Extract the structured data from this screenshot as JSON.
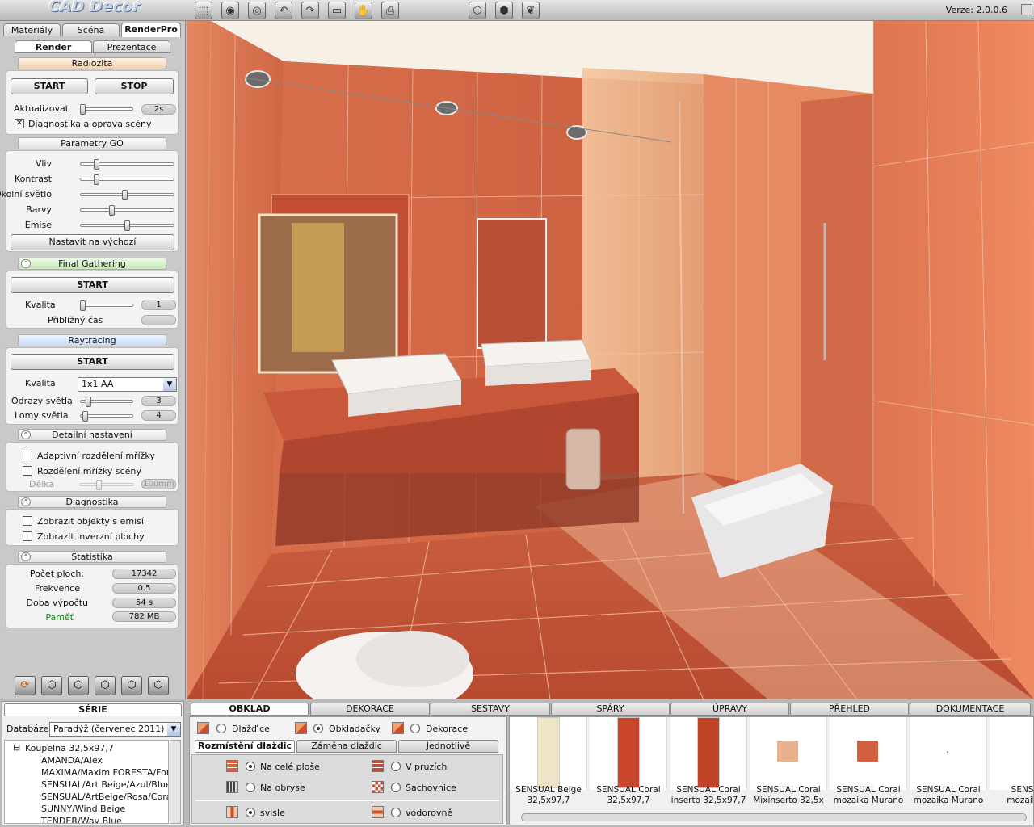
{
  "app": {
    "logo": "CAD Decor",
    "version": "Verze: 2.0.0.6"
  },
  "toolbar": {
    "icons": [
      "select-icon",
      "view-icon",
      "eye-icon",
      "undo-icon",
      "redo-icon",
      "window-icon",
      "hand-icon",
      "printer-icon",
      "cube-wire-icon",
      "cube-solid-icon",
      "butterfly-icon"
    ]
  },
  "left": {
    "tabs": [
      "Materiály",
      "Scéna",
      "RenderPro"
    ],
    "subtabs": [
      "Render",
      "Prezentace"
    ],
    "radiosity": {
      "title": "Radiozita",
      "start": "START",
      "stop": "STOP",
      "update_label": "Aktualizovat",
      "update_value": "2s",
      "update_level": 0.0,
      "diag_label": "Diagnostika a oprava scény",
      "diag_checked": true
    },
    "go": {
      "title": "Parametry GO",
      "reset": "Nastavit na výchozí",
      "params": [
        {
          "label": "Vliv",
          "level": 0.15
        },
        {
          "label": "Kontrast",
          "level": 0.15
        },
        {
          "label": "Okolní světlo",
          "level": 0.47
        },
        {
          "label": "Barvy",
          "level": 0.33
        },
        {
          "label": "Emise",
          "level": 0.5
        }
      ]
    },
    "fg": {
      "title": "Final Gathering",
      "start": "START",
      "quality_label": "Kvalita",
      "quality_value": "1",
      "quality_level": 0.0,
      "time_label": "Přibližný čas",
      "time_value": ""
    },
    "rt": {
      "title": "Raytracing",
      "start": "START",
      "quality_label": "Kvalita",
      "quality_value": "1x1 AA",
      "refl_label": "Odrazy světla",
      "refl_value": "3",
      "refl_level": 0.12,
      "refr_label": "Lomy světla",
      "refr_value": "4",
      "refr_level": 0.05
    },
    "detail": {
      "title": "Detailní nastavení",
      "adaptive": "Adaptivní rozdělení mřížky",
      "scene_grid": "Rozdělení mřížky scény",
      "length_label": "Délka",
      "length_value": "100mm"
    },
    "diag": {
      "title": "Diagnostika",
      "emit": "Zobrazit objekty s emisí",
      "inverse": "Zobrazit inverzní plochy"
    },
    "stats": {
      "title": "Statistika",
      "rows": [
        {
          "label": "Počet ploch:",
          "value": "17342"
        },
        {
          "label": "Frekvence",
          "value": "0.5"
        },
        {
          "label": "Doba výpočtu",
          "value": "54 s"
        },
        {
          "label": "Paměť",
          "value": "782 MB"
        }
      ]
    }
  },
  "bottom": {
    "series": {
      "title": "SÉRIE",
      "db_label": "Databáze",
      "db_value": "Paradýž (červenec 2011)",
      "tree": [
        "Koupelna 32,5x97,7",
        "AMANDA/Alex",
        "MAXIMA/Maxim FORESTA/For",
        "SENSUAL/Art Beige/Azul/Blue",
        "SENSUAL/ArtBeige/Rosa/Cora",
        "SUNNY/Wind Beige",
        "TENDER/Wav Blue"
      ]
    },
    "tabs": [
      "OBKLAD",
      "DEKORACE",
      "SESTAVY",
      "SPÁRY",
      "ÚPRAVY",
      "PŘEHLED",
      "DOKUMENTACE"
    ],
    "types": [
      "Dlažďice",
      "Obkladačky",
      "Dekorace"
    ],
    "subtabs": [
      "Rozmístění dlaždic",
      "Záměna dlaždic",
      "Jednotlivě"
    ],
    "options": {
      "whole": "Na celé ploše",
      "outline": "Na obryse",
      "strips": "V pruzích",
      "checker": "Šachovnice",
      "vertical": "svisle",
      "horizontal": "vodorovně"
    },
    "tiles": [
      {
        "name": "SENSUAL Beige",
        "size": "32,5x97,7",
        "color": "#efe3c8"
      },
      {
        "name": "SENSUAL Coral",
        "size": "32,5x97,7",
        "color": "#c9452b"
      },
      {
        "name": "SENSUAL Coral",
        "size": "inserto 32,5x97,7",
        "color": "#c24428"
      },
      {
        "name": "SENSUAL Coral",
        "size": "Mixinserto 32,5x",
        "color": "#e9b08e"
      },
      {
        "name": "SENSUAL Coral",
        "size": "mozaika Murano",
        "color": "#d0603e"
      },
      {
        "name": "SENSUAL Coral",
        "size": "mozaika Murano",
        "color": "#ffffff"
      },
      {
        "name": "SENSUA",
        "size": "mozaika P",
        "color": "#cf5a38"
      }
    ]
  }
}
